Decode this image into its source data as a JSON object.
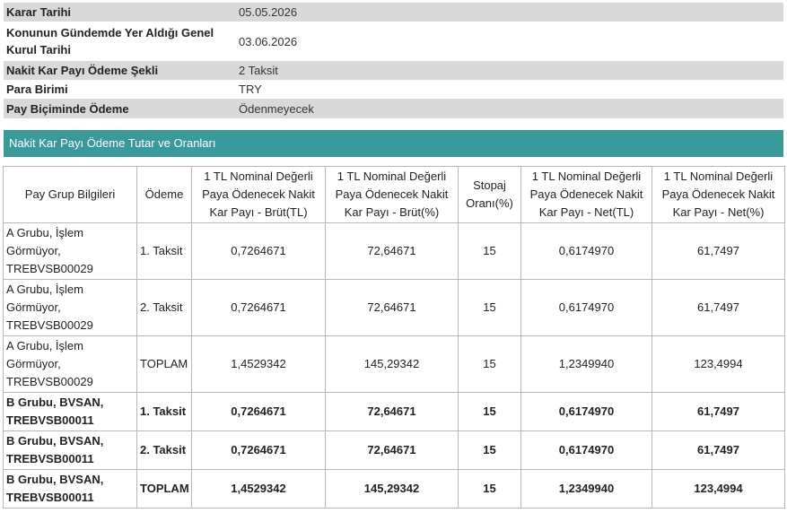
{
  "info": [
    {
      "label": "Karar Tarihi",
      "value": "05.05.2026"
    },
    {
      "label": "Konunun Gündemde Yer Aldığı Genel Kurul Tarihi",
      "value": "03.06.2026"
    },
    {
      "label": "Nakit Kar Payı Ödeme Şekli",
      "value": "2 Taksit"
    },
    {
      "label": "Para Birimi",
      "value": "TRY"
    },
    {
      "label": "Pay Biçiminde Ödeme",
      "value": "Ödenmeyecek"
    }
  ],
  "section_title": "Nakit Kar Payı Ödeme Tutar ve Oranları",
  "table": {
    "headers": [
      "Pay Grup Bilgileri",
      "Ödeme",
      "1 TL Nominal Değerli Paya Ödenecek Nakit Kar Payı - Brüt(TL)",
      "1 TL Nominal Değerli Paya Ödenecek Nakit Kar Payı - Brüt(%)",
      "Stopaj Oranı(%)",
      "1 TL Nominal Değerli Paya Ödenecek Nakit Kar Payı - Net(TL)",
      "1 TL Nominal Değerli Paya Ödenecek Nakit Kar Payı - Net(%)"
    ],
    "rows": [
      [
        "A Grubu, İşlem Görmüyor, TREBVSB00029",
        "1. Taksit",
        "0,7264671",
        "72,64671",
        "15",
        "0,6174970",
        "61,7497"
      ],
      [
        "A Grubu, İşlem Görmüyor, TREBVSB00029",
        "2. Taksit",
        "0,7264671",
        "72,64671",
        "15",
        "0,6174970",
        "61,7497"
      ],
      [
        "A Grubu, İşlem Görmüyor, TREBVSB00029",
        "TOPLAM",
        "1,4529342",
        "145,29342",
        "15",
        "1,2349940",
        "123,4994"
      ],
      [
        "B Grubu, BVSAN, TREBVSB00011",
        "1. Taksit",
        "0,7264671",
        "72,64671",
        "15",
        "0,6174970",
        "61,7497"
      ],
      [
        "B Grubu, BVSAN, TREBVSB00011",
        "2. Taksit",
        "0,7264671",
        "72,64671",
        "15",
        "0,6174970",
        "61,7497"
      ],
      [
        "B Grubu, BVSAN, TREBVSB00011",
        "TOPLAM",
        "1,4529342",
        "145,29342",
        "15",
        "1,2349940",
        "123,4994"
      ]
    ]
  }
}
